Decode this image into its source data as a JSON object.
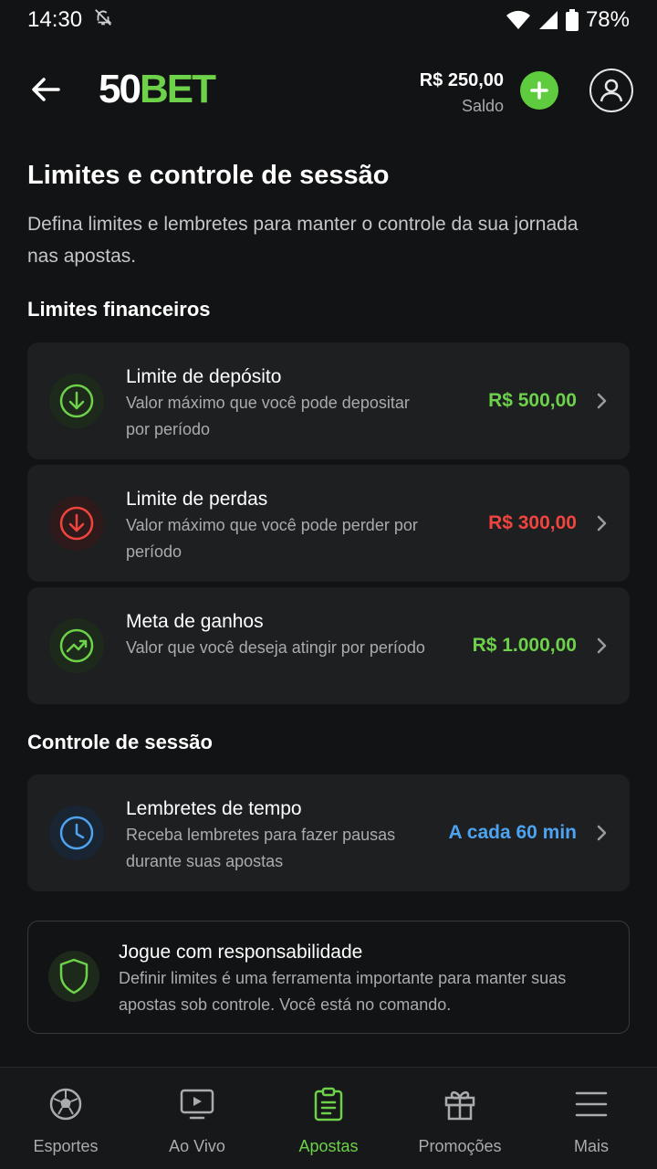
{
  "status_bar": {
    "time": "14:30",
    "battery": "78%"
  },
  "header": {
    "logo_number": "50",
    "logo_word": "BET",
    "balance_amount": "R$ 250,00",
    "balance_label": "Saldo"
  },
  "page": {
    "title": "Limites e controle de sessão",
    "description": "Defina limites e lembretes para manter o controle da sua jornada nas apostas."
  },
  "financial": {
    "section_title": "Limites financeiros",
    "items": [
      {
        "title": "Limite de depósito",
        "description": "Valor máximo que você pode depositar por período",
        "value": "R$ 500,00",
        "icon": "download-icon",
        "value_color": "#6dd14a"
      },
      {
        "title": "Limite de perdas",
        "description": "Valor máximo que você pode perder por período",
        "value": "R$ 300,00",
        "icon": "arrow-down-circle-icon",
        "value_color": "#f0453f"
      },
      {
        "title": "Meta de ganhos",
        "description": "Valor que você deseja atingir por período",
        "value": "R$ 1.000,00",
        "icon": "trending-up-icon",
        "value_color": "#6dd14a"
      }
    ]
  },
  "session": {
    "section_title": "Controle de sessão",
    "items": [
      {
        "title": "Lembretes de tempo",
        "description": "Receba lembretes para fazer pausas durante suas apostas",
        "value": "A cada 60 min",
        "icon": "clock-icon",
        "value_color": "#4ea3f1"
      }
    ]
  },
  "responsible": {
    "title": "Jogue com responsabilidade",
    "description": "Definir limites é uma ferramenta importante para manter suas apostas sob controle. Você está no comando.",
    "icon": "shield-icon"
  },
  "nav": {
    "items": [
      {
        "label": "Esportes",
        "icon": "soccer-ball-icon",
        "active": false
      },
      {
        "label": "Ao Vivo",
        "icon": "live-play-icon",
        "active": false
      },
      {
        "label": "Apostas",
        "icon": "clipboard-icon",
        "active": true
      },
      {
        "label": "Promoções",
        "icon": "gift-icon",
        "active": false
      },
      {
        "label": "Mais",
        "icon": "menu-icon",
        "active": false
      }
    ]
  },
  "colors": {
    "accent": "#6dd14a",
    "danger": "#f0453f",
    "info": "#4ea3f1",
    "background": "#121314",
    "card": "#1d1f21"
  }
}
